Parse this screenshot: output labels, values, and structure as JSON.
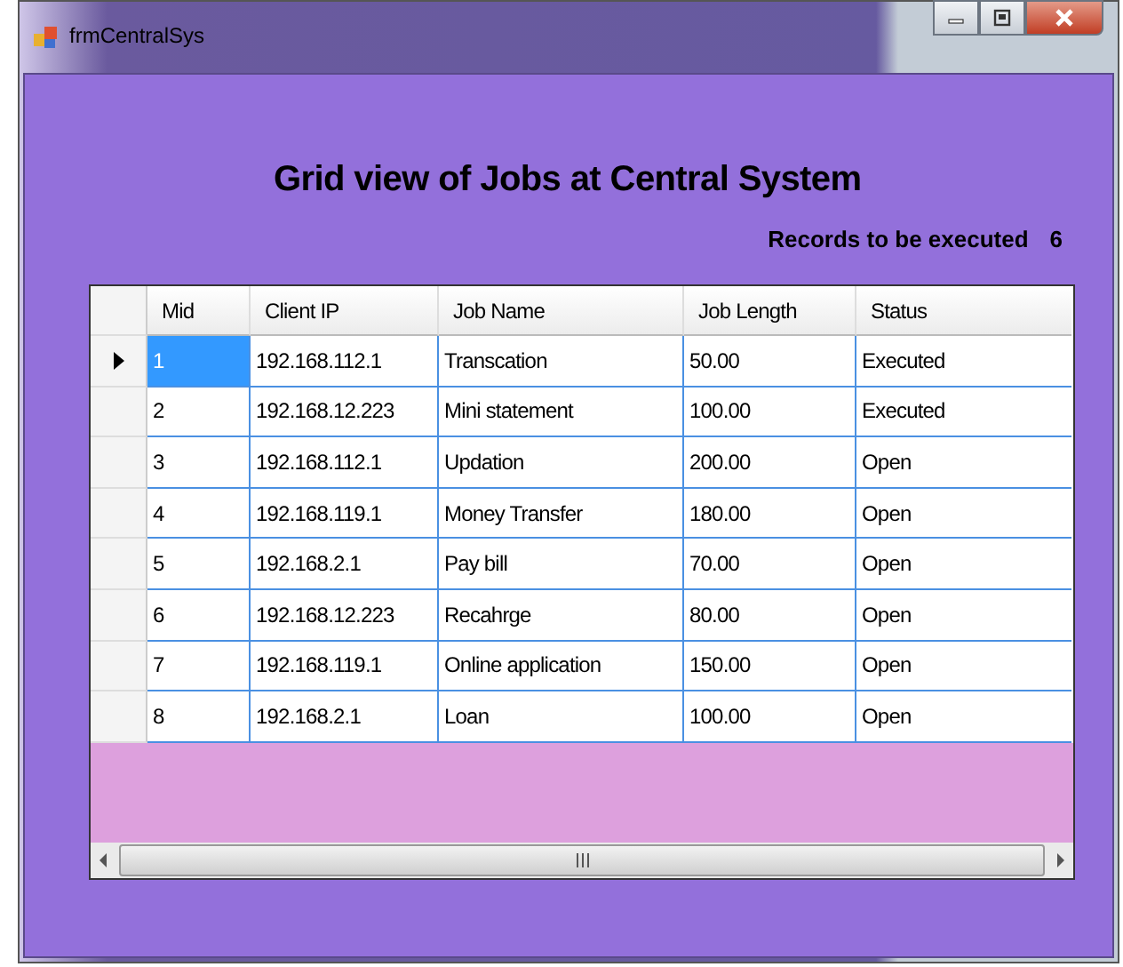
{
  "window": {
    "title": "frmCentralSys"
  },
  "heading": "Grid view of Jobs at Central System",
  "records": {
    "label": "Records to be executed",
    "value": "6"
  },
  "table": {
    "columns": [
      "Mid",
      "Client IP",
      "Job Name",
      "Job Length",
      "Status"
    ],
    "rows": [
      {
        "cells": [
          "1",
          "192.168.112.1",
          " Transcation",
          "50.00",
          "Executed"
        ],
        "selected": true
      },
      {
        "cells": [
          "2",
          "192.168.12.223",
          "Mini statement",
          "100.00",
          "Executed"
        ],
        "selected": false
      },
      {
        "cells": [
          "3",
          "192.168.112.1",
          "Updation",
          "200.00",
          "Open"
        ],
        "selected": false
      },
      {
        "cells": [
          "4",
          "192.168.119.1",
          "Money Transfer",
          "180.00",
          "Open"
        ],
        "selected": false
      },
      {
        "cells": [
          "5",
          "192.168.2.1",
          "Pay bill",
          "70.00",
          "Open"
        ],
        "selected": false
      },
      {
        "cells": [
          "6",
          "192.168.12.223",
          "Recahrge",
          "80.00",
          "Open"
        ],
        "selected": false
      },
      {
        "cells": [
          "7",
          "192.168.119.1",
          "Online application",
          "150.00",
          "Open"
        ],
        "selected": false
      },
      {
        "cells": [
          "8",
          "192.168.2.1",
          "Loan",
          "100.00",
          "Open"
        ],
        "selected": false
      }
    ]
  }
}
